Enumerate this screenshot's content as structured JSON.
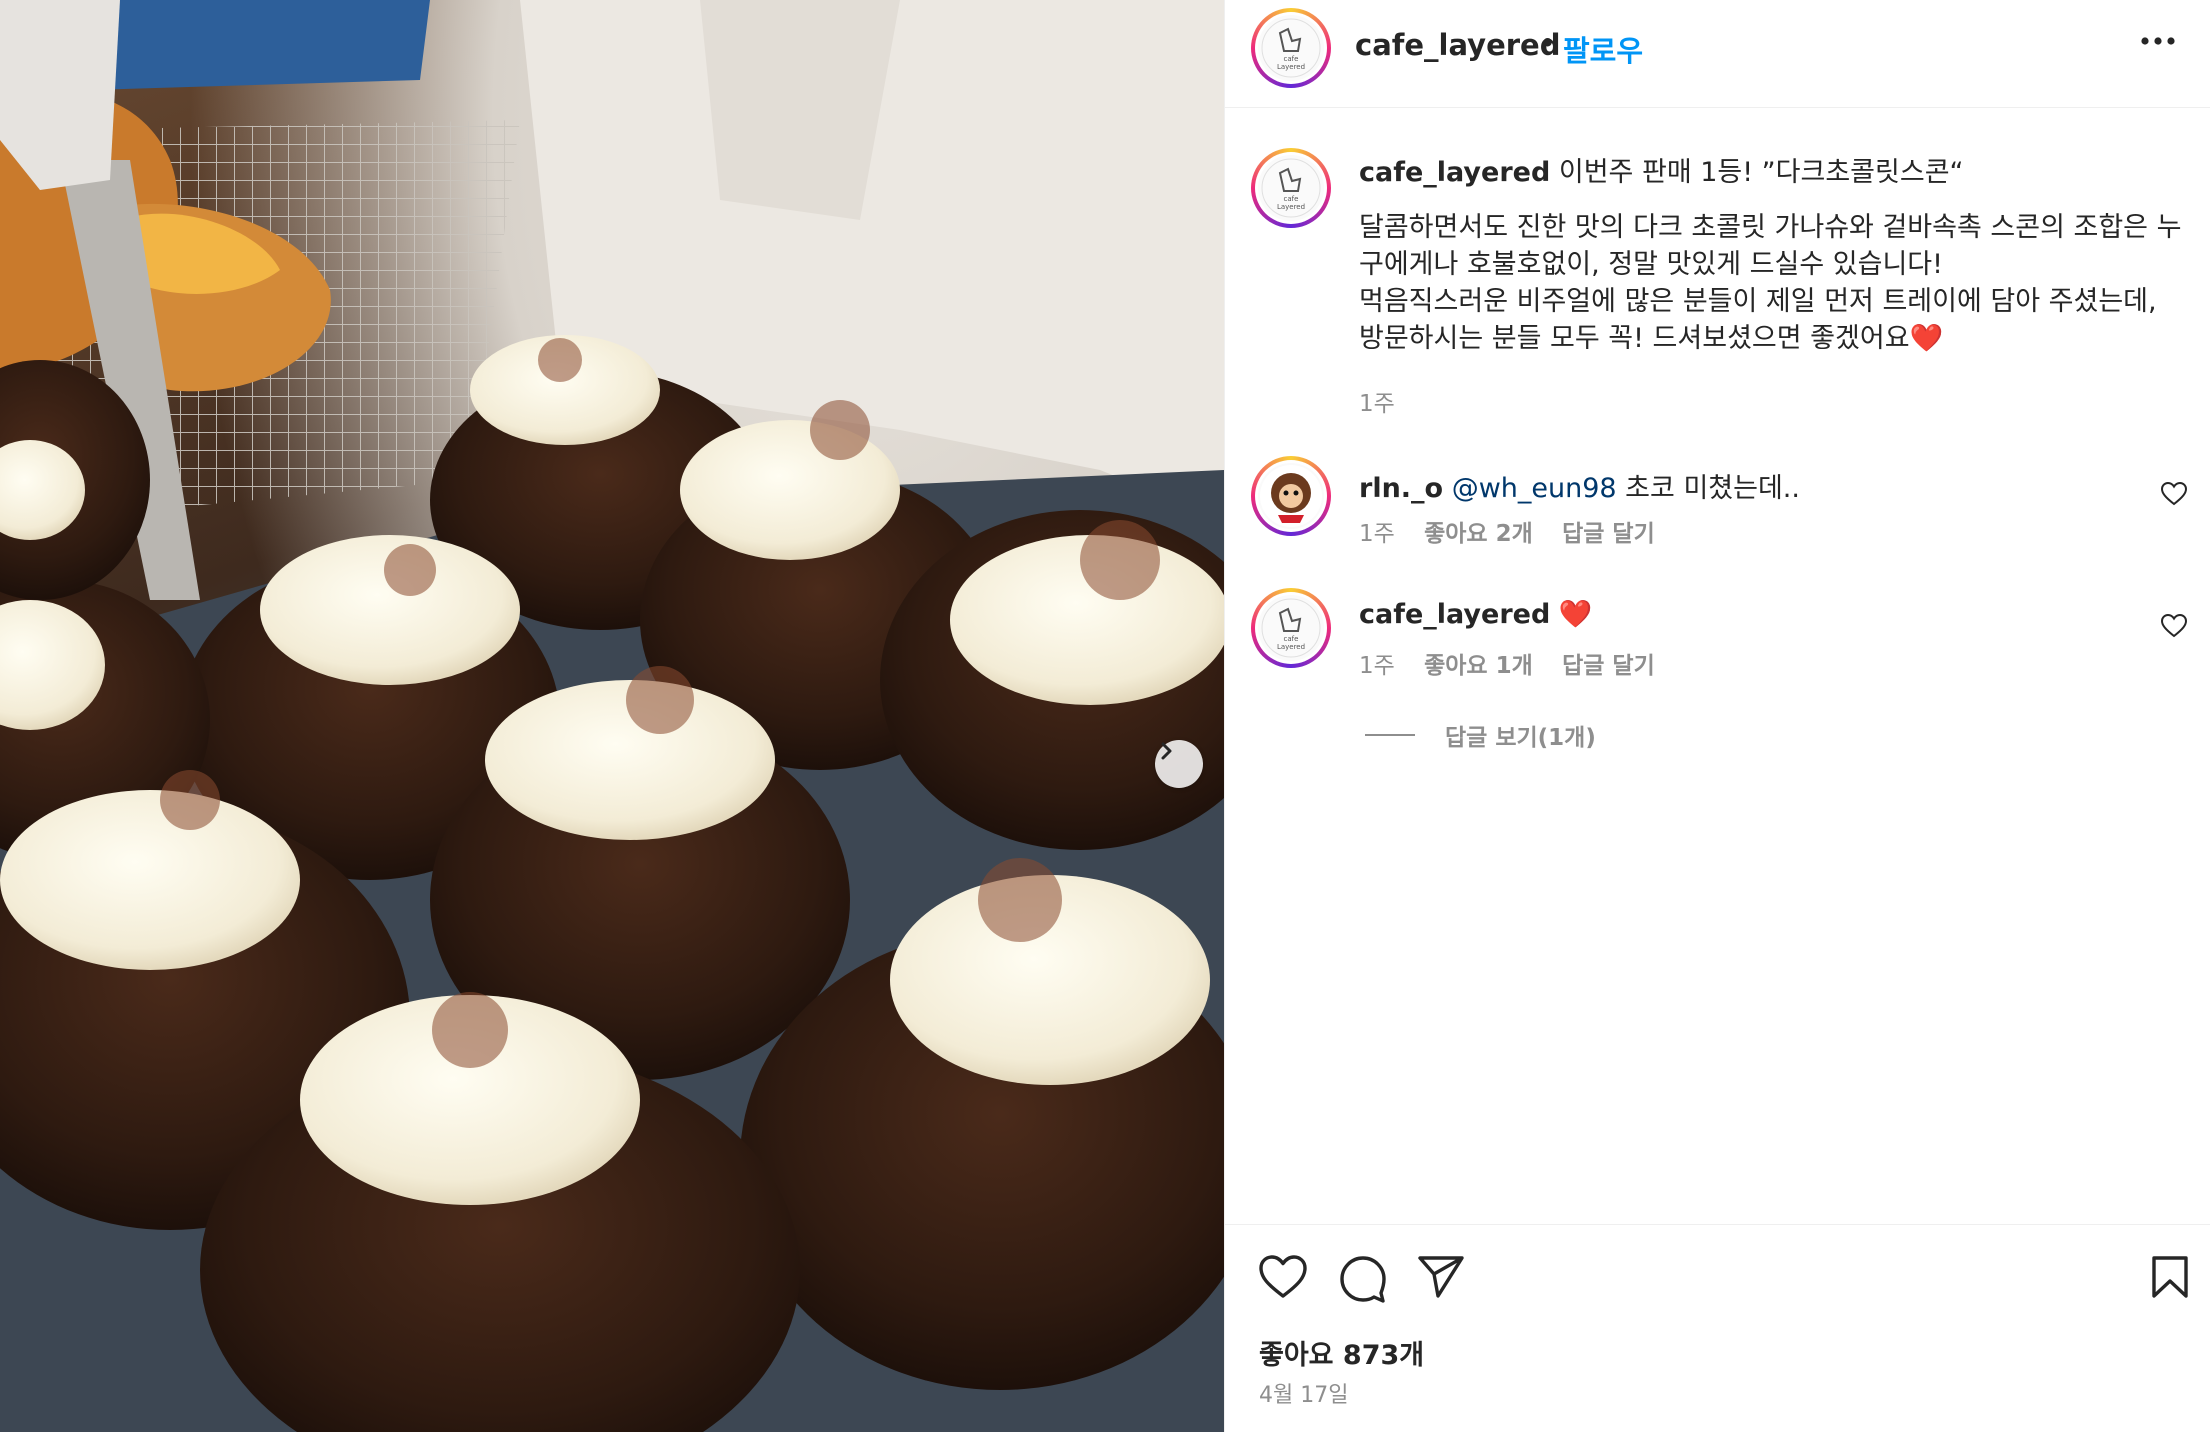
{
  "post": {
    "username": "cafe_layered",
    "separator": "•",
    "follow_label": "팔로우",
    "more_icon": "more-horizontal-icon",
    "avatar_label_top": "cafe",
    "avatar_label_bottom": "Layered"
  },
  "caption": {
    "username": "cafe_layered",
    "line1": " 이번주 판매 1등! ”다크초콜릿스콘“",
    "line2": "달콤하면서도 진한 맛의 다크 초콜릿 가나슈와 겉바속촉 스콘의 조합은 누구에게나 호불호없이, 정말 맛있게 드실수 있습니다!",
    "line3": "먹음직스러운 비주얼에 많은 분들이 제일 먼저 트레이에 담아 주셨는데, 방문하시는 분들 모두 꼭! 드셔보셨으면 좋겠어요",
    "heart_emoji": "❤️",
    "time": "1주"
  },
  "comments": [
    {
      "username": "rln._o",
      "mention": "@wh_eun98",
      "text": " 초코 미쳤는데..",
      "time": "1주",
      "likes": "좋아요 2개",
      "reply": "답글 달기"
    },
    {
      "username": "cafe_layered",
      "mention": "",
      "text": " ❤️",
      "time": "1주",
      "likes": "좋아요 1개",
      "reply": "답글 달기"
    }
  ],
  "view_replies": "답글 보기(1개)",
  "footer": {
    "likes": "좋아요 873개",
    "date": "4월 17일"
  },
  "colors": {
    "link": "#0095f6",
    "mention": "#00376b",
    "muted": "#8e8e8e",
    "text": "#262626"
  }
}
